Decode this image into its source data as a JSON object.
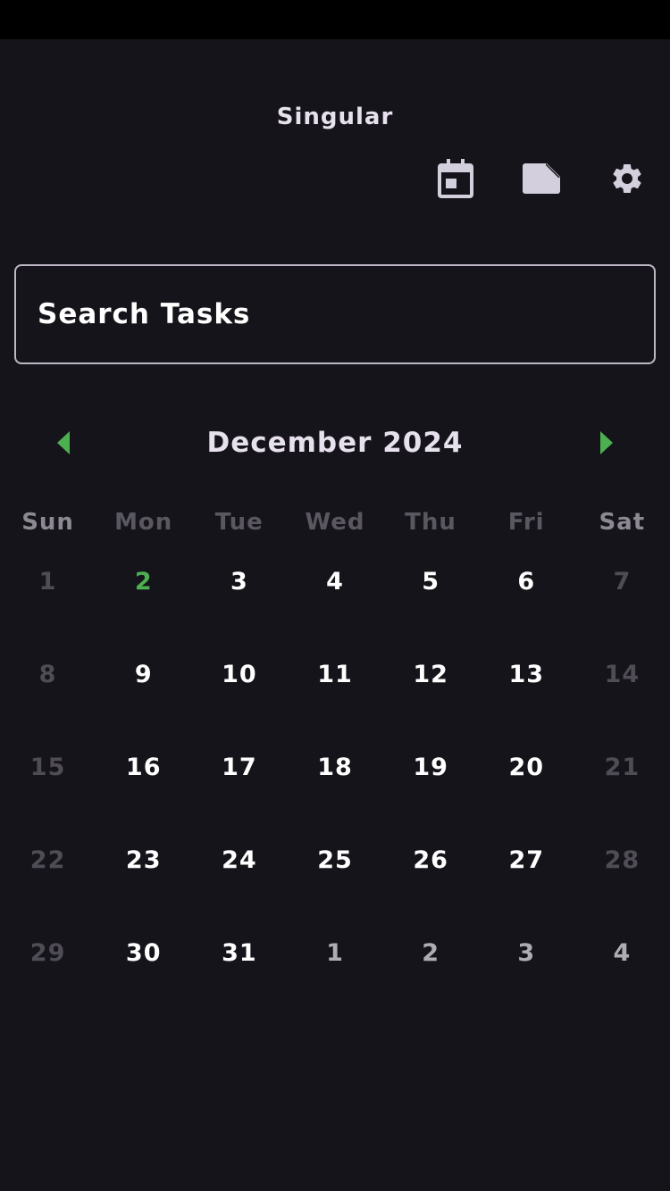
{
  "app": {
    "title": "Singular"
  },
  "toolbar": {
    "icons": [
      "calendar-icon",
      "note-icon",
      "gear-icon"
    ],
    "icon_color": "#d4cfdc"
  },
  "search": {
    "placeholder": "Search Tasks"
  },
  "calendar": {
    "month_title": "December 2024",
    "arrow_color": "#4caf50",
    "weekdays": [
      "Sun",
      "Mon",
      "Tue",
      "Wed",
      "Thu",
      "Fri",
      "Sat"
    ],
    "weeks": [
      [
        "1",
        "2",
        "3",
        "4",
        "5",
        "6",
        "7"
      ],
      [
        "8",
        "9",
        "10",
        "11",
        "12",
        "13",
        "14"
      ],
      [
        "15",
        "16",
        "17",
        "18",
        "19",
        "20",
        "21"
      ],
      [
        "22",
        "23",
        "24",
        "25",
        "26",
        "27",
        "28"
      ],
      [
        "29",
        "30",
        "31",
        "1",
        "2",
        "3",
        "4"
      ]
    ],
    "today": "2",
    "outside_month_start_index": 3
  }
}
